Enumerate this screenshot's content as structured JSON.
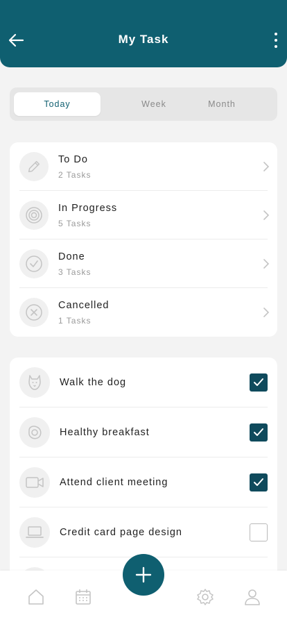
{
  "header": {
    "title": "My Task"
  },
  "tabs": [
    {
      "label": "Today",
      "active": true
    },
    {
      "label": "Week",
      "active": false
    },
    {
      "label": "Month",
      "active": false
    }
  ],
  "status_list": [
    {
      "name": "To Do",
      "count": "2 Tasks",
      "icon": "pencil-icon"
    },
    {
      "name": "In Progress",
      "count": "5 Tasks",
      "icon": "target-icon"
    },
    {
      "name": "Done",
      "count": "3 Tasks",
      "icon": "check-circle-icon"
    },
    {
      "name": "Cancelled",
      "count": "1 Tasks",
      "icon": "x-circle-icon"
    }
  ],
  "tasks": [
    {
      "name": "Walk the dog",
      "icon": "dog-icon",
      "checked": true
    },
    {
      "name": "Healthy breakfast",
      "icon": "egg-icon",
      "checked": true
    },
    {
      "name": "Attend client meeting",
      "icon": "video-icon",
      "checked": true
    },
    {
      "name": "Credit card page design",
      "icon": "laptop-icon",
      "checked": false
    }
  ],
  "bottom_nav": [
    {
      "icon": "home-icon"
    },
    {
      "icon": "calendar-icon"
    },
    {
      "icon": "settings-icon"
    },
    {
      "icon": "profile-icon"
    }
  ],
  "colors": {
    "primary": "#0f5f70",
    "checkbox_checked": "#0f4a5c",
    "background": "#f3f3f3",
    "icon_gray": "#c4c4c4"
  }
}
